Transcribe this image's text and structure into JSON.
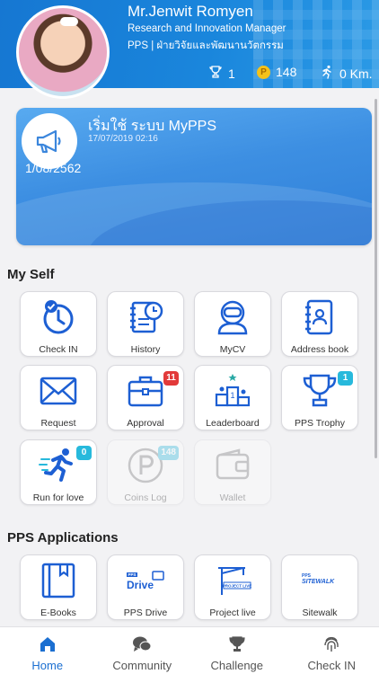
{
  "profile": {
    "name": "Mr.Jenwit Romyen",
    "role": "Research and Innovation Manager",
    "department": "PPS | ฝ่ายวิจัยและพัฒนานวัตกรรม",
    "trophies": "1",
    "coins": "148",
    "coin_symbol": "P",
    "distance": "0 Km."
  },
  "news": {
    "title": "เริ่มใช้ ระบบ MyPPS",
    "date": "17/07/2019 02:16",
    "body": "1/08/2562"
  },
  "sections": {
    "myself": "My Self",
    "apps": "PPS Applications"
  },
  "tiles": {
    "checkin": "Check IN",
    "history": "History",
    "mycv": "MyCV",
    "addressbook": "Address book",
    "request": "Request",
    "approval": "Approval",
    "approval_badge": "11",
    "leaderboard": "Leaderboard",
    "trophy": "PPS Trophy",
    "trophy_badge": "1",
    "run": "Run for love",
    "run_badge": "0",
    "coinslog": "Coins Log",
    "coinslog_badge": "148",
    "wallet": "Wallet",
    "ebooks": "E-Books",
    "drive": "PPS Drive",
    "projectlive": "Project live",
    "sitewalk": "Sitewalk"
  },
  "icon_text": {
    "drive_top": "PPS",
    "drive_main": "Drive",
    "projectlive": "PROJECT LIVE",
    "sitewalk_top": "PPS",
    "sitewalk_main": "SITEWALK",
    "leader_rank": "1"
  },
  "nav": {
    "home": "Home",
    "community": "Community",
    "challenge": "Challenge",
    "checkin": "Check IN"
  },
  "colors": {
    "header": "#1677d2",
    "accent": "#1b6fd1",
    "badge_red": "#e23a3a",
    "badge_cyan": "#27b9dc"
  }
}
